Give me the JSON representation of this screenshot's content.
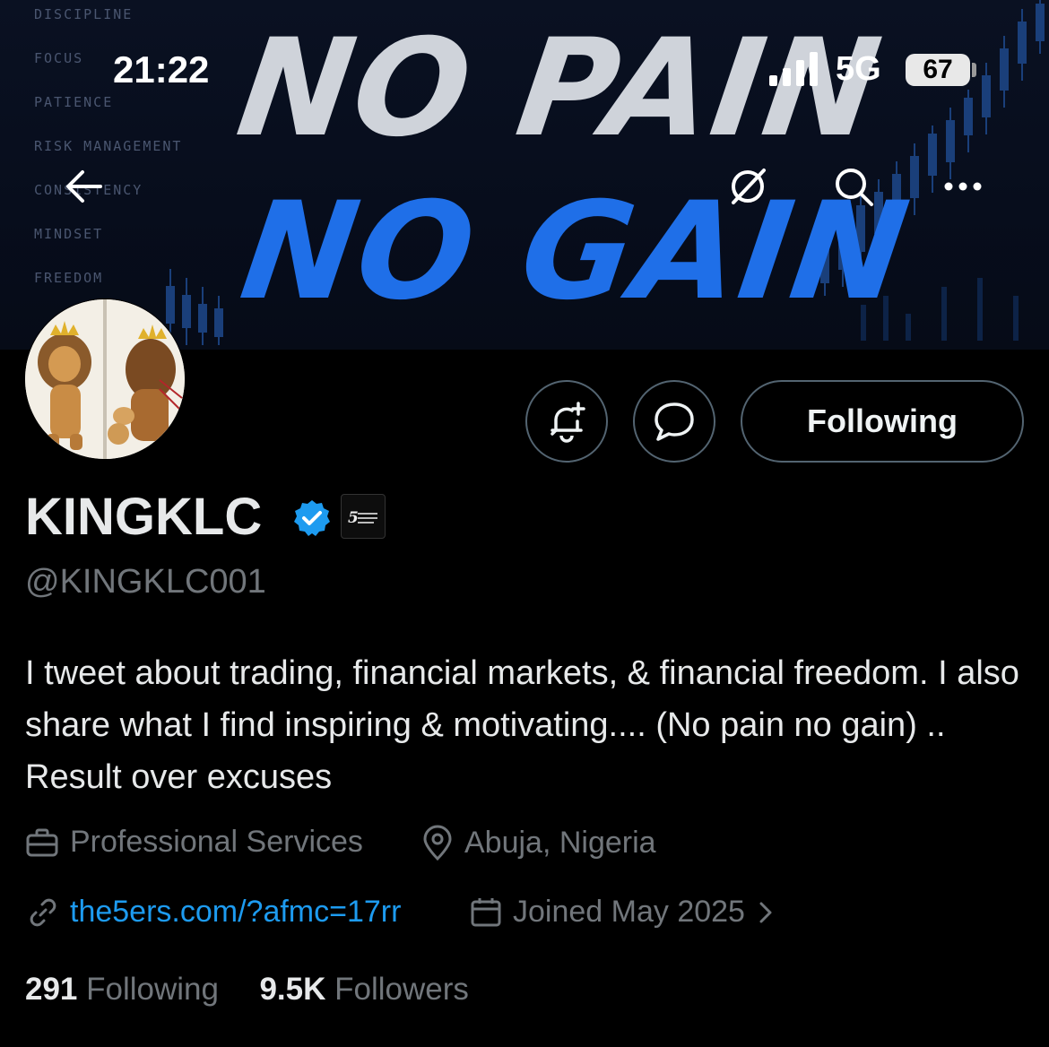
{
  "status_bar": {
    "time": "21:22",
    "network": "5G",
    "battery": "67"
  },
  "banner": {
    "headline_line1": "NO PAIN",
    "headline_line2": "NO GAIN",
    "side_words": [
      "DISCIPLINE",
      "FOCUS",
      "PATIENCE",
      "RISK MANAGEMENT",
      "CONSISTENCY",
      "MINDSET",
      "FREEDOM"
    ]
  },
  "nav": {
    "back": "back-icon",
    "grok": "grok-icon",
    "search": "search-icon",
    "more": "more-icon"
  },
  "actions": {
    "notify_icon": "bell-plus-icon",
    "message_icon": "message-icon",
    "following_label": "Following"
  },
  "profile": {
    "name": "KINGKLC",
    "handle": "@KINGKLC001",
    "bio": "I tweet about trading, financial markets, & financial freedom. I also share what I find inspiring & motivating.... (No pain no gain) .. Result over excuses",
    "category": "Professional Services",
    "location": "Abuja, Nigeria",
    "link": "the5ers.com/?afmc=17rr",
    "joined": "Joined May 2025"
  },
  "stats": {
    "following_count": "291",
    "following_label": "Following",
    "followers_count": "9.5K",
    "followers_label": "Followers"
  },
  "colors": {
    "accent_blue": "#1d9bf0",
    "muted": "#71767b",
    "border": "#536471",
    "banner_blue": "#1f6fe8"
  }
}
